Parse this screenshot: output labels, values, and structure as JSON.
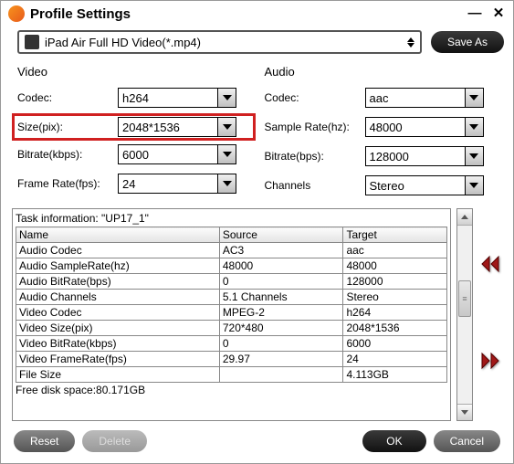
{
  "window": {
    "title": "Profile Settings"
  },
  "profile": {
    "name": "iPad Air Full HD Video(*.mp4)",
    "saveAs": "Save As"
  },
  "video": {
    "title": "Video",
    "codec": {
      "label": "Codec:",
      "value": "h264"
    },
    "size": {
      "label": "Size(pix):",
      "value": "2048*1536"
    },
    "bitrate": {
      "label": "Bitrate(kbps):",
      "value": "6000"
    },
    "framerate": {
      "label": "Frame Rate(fps):",
      "value": "24"
    }
  },
  "audio": {
    "title": "Audio",
    "codec": {
      "label": "Codec:",
      "value": "aac"
    },
    "samplerate": {
      "label": "Sample Rate(hz):",
      "value": "48000"
    },
    "bitrate": {
      "label": "Bitrate(bps):",
      "value": "128000"
    },
    "channels": {
      "label": "Channels",
      "value": "Stereo"
    }
  },
  "task": {
    "title": "Task information: \"UP17_1\"",
    "headers": {
      "name": "Name",
      "source": "Source",
      "target": "Target"
    },
    "rows": [
      {
        "name": "Audio Codec",
        "source": "AC3",
        "target": "aac"
      },
      {
        "name": "Audio SampleRate(hz)",
        "source": "48000",
        "target": "48000"
      },
      {
        "name": "Audio BitRate(bps)",
        "source": "0",
        "target": "128000"
      },
      {
        "name": "Audio Channels",
        "source": "5.1 Channels",
        "target": "Stereo"
      },
      {
        "name": "Video Codec",
        "source": "MPEG-2",
        "target": "h264"
      },
      {
        "name": "Video Size(pix)",
        "source": "720*480",
        "target": "2048*1536"
      },
      {
        "name": "Video BitRate(kbps)",
        "source": "0",
        "target": "6000"
      },
      {
        "name": "Video FrameRate(fps)",
        "source": "29.97",
        "target": "24"
      },
      {
        "name": "File Size",
        "source": "",
        "target": "4.113GB"
      }
    ],
    "freedisk": "Free disk space:80.171GB"
  },
  "footer": {
    "reset": "Reset",
    "delete": "Delete",
    "ok": "OK",
    "cancel": "Cancel"
  }
}
